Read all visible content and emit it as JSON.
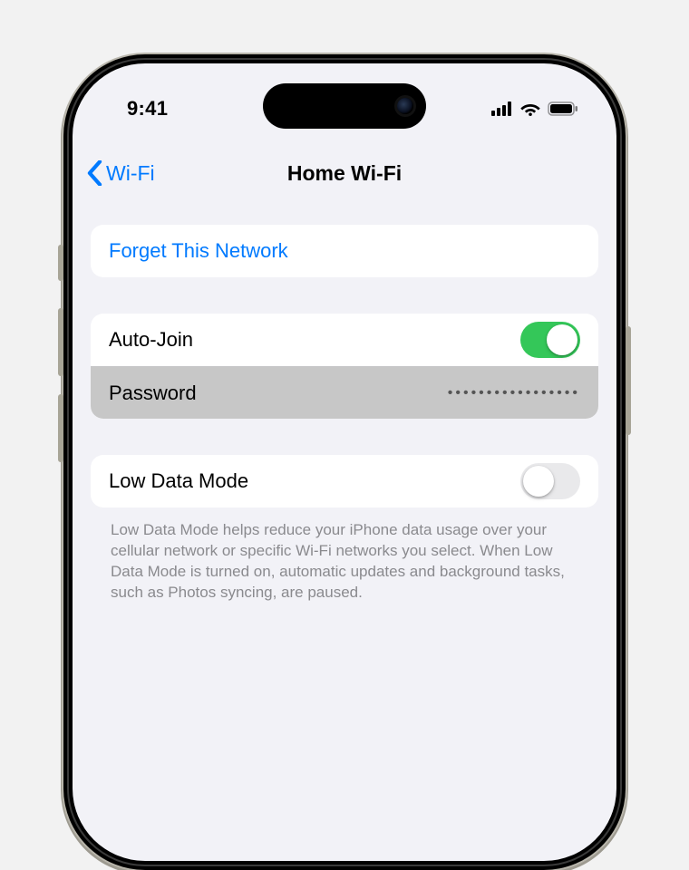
{
  "statusbar": {
    "time": "9:41"
  },
  "nav": {
    "back_label": "Wi-Fi",
    "title": "Home Wi-Fi"
  },
  "forget": {
    "label": "Forget This Network"
  },
  "settings": {
    "auto_join": {
      "label": "Auto-Join",
      "on": true
    },
    "password": {
      "label": "Password",
      "masked_value": "•••••••••••••••••"
    },
    "low_data": {
      "label": "Low Data Mode",
      "on": false
    }
  },
  "footer": {
    "text": "Low Data Mode helps reduce your iPhone data usage over your cellular network or specific Wi-Fi networks you select. When Low Data Mode is turned on, automatic updates and background tasks, such as Photos syncing, are paused."
  },
  "colors": {
    "accent": "#007aff",
    "toggle_on": "#34c759",
    "bg": "#f2f2f7"
  }
}
